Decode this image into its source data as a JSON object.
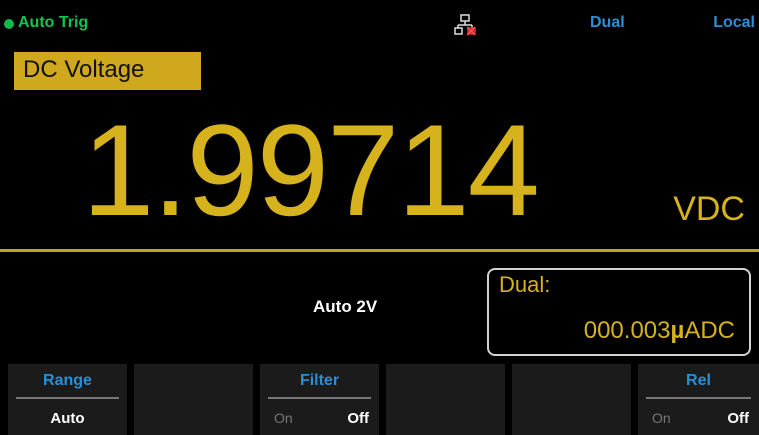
{
  "status": {
    "trigger": "Auto  Trig",
    "dual": "Dual",
    "local": "Local",
    "lan_icon": "lan-disconnected-icon"
  },
  "function_label": "DC Voltage",
  "main_reading": "1.99714",
  "main_unit": "VDC",
  "range_info": "Auto  2V",
  "dual_panel": {
    "label": "Dual:",
    "value": "000.003",
    "unit_prefix": "µ",
    "unit": "ADC"
  },
  "softkeys": [
    {
      "title": "Range",
      "value": "Auto"
    },
    {
      "title": "",
      "value": ""
    },
    {
      "title": "Filter",
      "on": "On",
      "off": "Off"
    },
    {
      "title": "",
      "value": ""
    },
    {
      "title": "",
      "value": ""
    },
    {
      "title": "Rel",
      "on": "On",
      "off": "Off"
    }
  ],
  "colors": {
    "accent_yellow": "#d6b21c",
    "status_green": "#13c24f",
    "status_blue": "#2a8fd6",
    "softkey_bg": "#1b1b1b"
  }
}
